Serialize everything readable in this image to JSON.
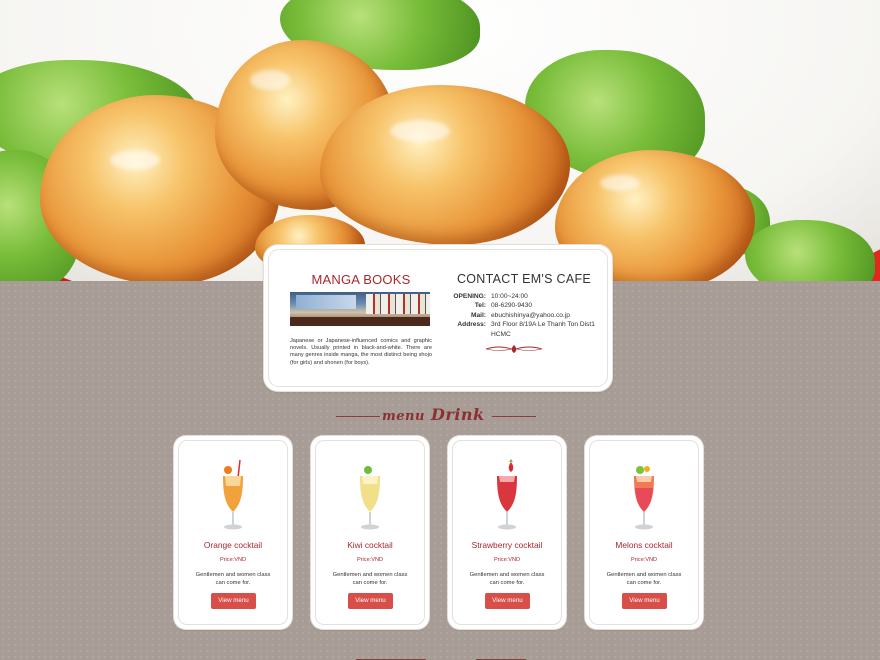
{
  "manga": {
    "title": "MANGA BOOKS",
    "description": "Japanese or Japanese-influenced comics and graphic novels. Usually printed in black-and-white. There are many genres inside manga, the most distinct being shojo (for girls) and shonen (for boys)."
  },
  "contact": {
    "title": "CONTACT EM'S CAFE",
    "rows": [
      {
        "label": "OPENING:",
        "value": "10:00~24:00"
      },
      {
        "label": "Tel:",
        "value": "08-6290-9430"
      },
      {
        "label": "Mail:",
        "value": "ebuchishinya@yahoo.co.jp"
      },
      {
        "label": "Address:",
        "value": "3rd Floor 8/19A Le Thanh Ton Dist1 HCMC"
      }
    ]
  },
  "drink_section": {
    "word1": "menu",
    "word2": "Drink"
  },
  "drinks": [
    {
      "name": "Orange cocktail",
      "price": "Price:VND",
      "desc": "Gentlemen and women class can come for.",
      "button": "View menu",
      "color": "#f2a23c",
      "garnish": "#f07a1c"
    },
    {
      "name": "Kiwi cocktail",
      "price": "Price:VND",
      "desc": "Gentlemen and women class can come for.",
      "button": "View menu",
      "color": "#f2df8a",
      "garnish": "#6bbd3a"
    },
    {
      "name": "Strawberry cocktail",
      "price": "Price:VND",
      "desc": "Gentlemen and women class can come for.",
      "button": "View menu",
      "color": "#d9363e",
      "garnish": "#e0262e"
    },
    {
      "name": "Melons cocktail",
      "price": "Price:VND",
      "desc": "Gentlemen and women class can come for.",
      "button": "View menu",
      "color": "#f27a52",
      "garnish": "#7cc23c"
    }
  ],
  "colors": {
    "accent": "#a8292d",
    "button": "#d84e49",
    "background": "#a79d96"
  }
}
